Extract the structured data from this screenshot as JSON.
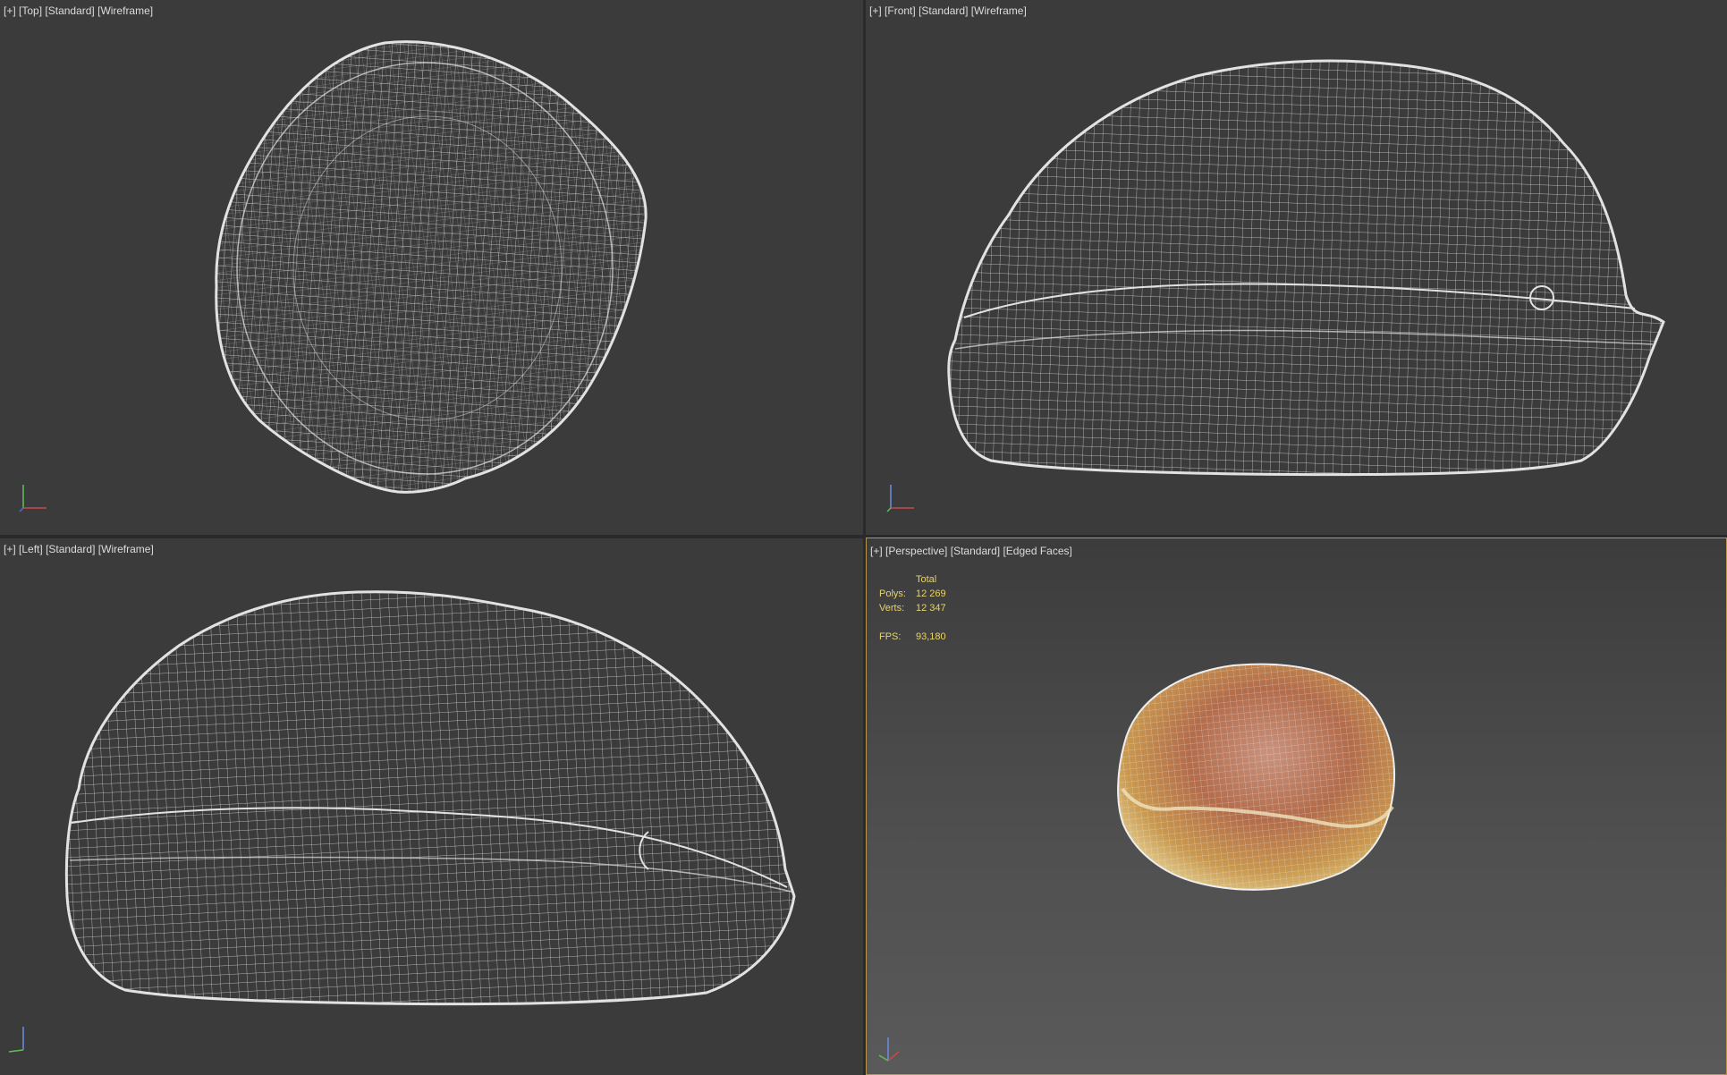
{
  "viewports": {
    "top": {
      "plus": "[+]",
      "view": "[Top]",
      "mode": "[Standard]",
      "shading": "[Wireframe]"
    },
    "front": {
      "plus": "[+]",
      "view": "[Front]",
      "mode": "[Standard]",
      "shading": "[Wireframe]"
    },
    "left": {
      "plus": "[+]",
      "view": "[Left]",
      "mode": "[Standard]",
      "shading": "[Wireframe]"
    },
    "perspective": {
      "plus": "[+]",
      "view": "[Perspective]",
      "mode": "[Standard]",
      "shading": "[Edged Faces]"
    }
  },
  "stats": {
    "header": "Total",
    "polys_label": "Polys:",
    "polys_value": "12 269",
    "verts_label": "Verts:",
    "verts_value": "12 347",
    "fps_label": "FPS:",
    "fps_value": "93,180"
  },
  "colors": {
    "viewport_bg": "#3b3b3b",
    "wire": "#dcdcdc",
    "active_border": "#b8954a",
    "stats_text": "#e8d36a"
  },
  "icons": [
    "axis-gizmo-icon"
  ]
}
